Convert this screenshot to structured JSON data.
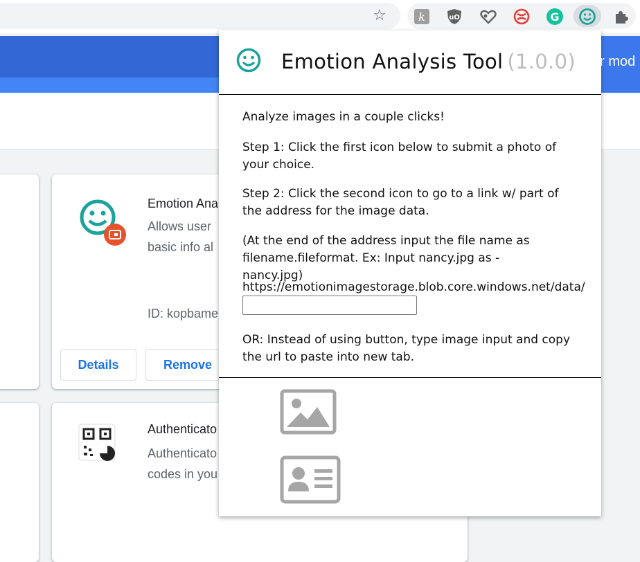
{
  "toolbar": {
    "star_icon": "star-icon",
    "extensions": [
      {
        "name": "k-extension-icon"
      },
      {
        "name": "ublock-icon"
      },
      {
        "name": "puzzle-heart-icon"
      },
      {
        "name": "red-swirl-icon"
      },
      {
        "name": "grammarly-icon"
      },
      {
        "name": "emotion-smiley-icon"
      },
      {
        "name": "extensions-puzzle-icon"
      }
    ]
  },
  "background": {
    "header_right_text": "er mod",
    "card1": {
      "title": "Emotion Ana",
      "desc_line1": "Allows user",
      "desc_line2": "basic info al",
      "id_text": "ID: kopbame",
      "details_label": "Details",
      "remove_label": "Remove"
    },
    "card2": {
      "title": "Authenticato",
      "desc_line1": "Authenticato",
      "desc_line2": "codes in you"
    }
  },
  "popup": {
    "title": "Emotion Analysis Tool",
    "version": "(1.0.0)",
    "intro": "Analyze images in a couple clicks!",
    "step1": "Step 1: Click the first icon below to submit a photo of your choice.",
    "step2": "Step 2: Click the second icon to go to a link w/ part of the address for the image data.",
    "note": "(At the end of the address input the file name as filename.fileformat. Ex: Input nancy.jpg as -nancy.jpg)",
    "base_url": "https://emotionimagestorage.blob.core.windows.net/data/",
    "input_value": "",
    "or_text": "OR: Instead of using button, type image input and copy the url to paste into new tab.",
    "upload_icon": "image-upload-icon",
    "link_icon": "id-card-icon"
  },
  "colors": {
    "teal": "#1aa39a",
    "chrome_blue": "#3367d6",
    "link_blue": "#1a73e8",
    "icon_gray": "#a6a6a6",
    "badge_orange": "#e6522c"
  }
}
